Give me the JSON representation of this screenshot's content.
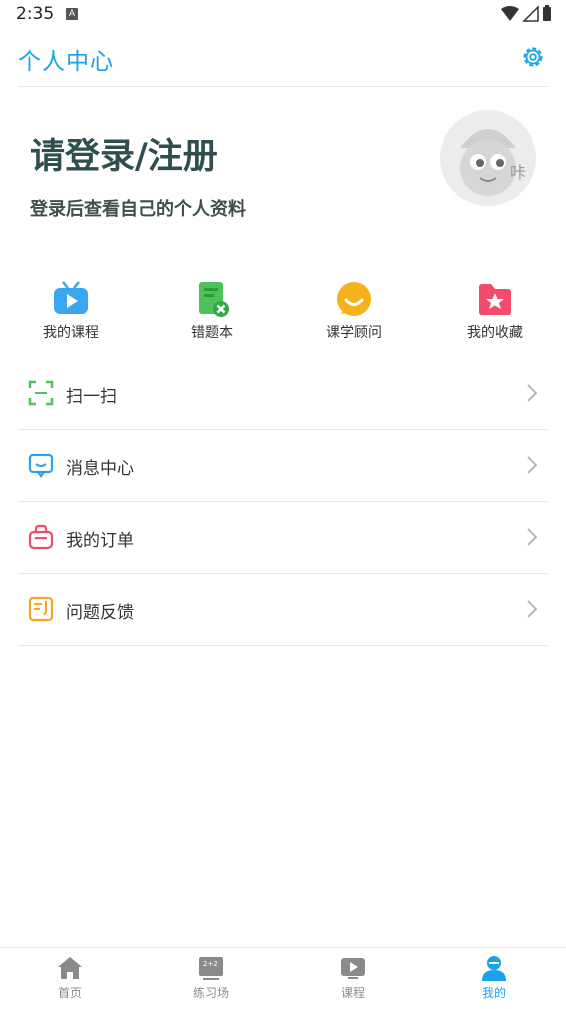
{
  "status": {
    "time": "2:35",
    "notification_letter": "A"
  },
  "header": {
    "title": "个人中心",
    "settings_icon": "gear-icon"
  },
  "profile": {
    "login_title": "请登录/注册",
    "login_subtitle": "登录后查看自己的个人资料",
    "avatar_icon": "mascot-avatar"
  },
  "quick_actions": [
    {
      "label": "我的课程",
      "icon": "video-tv-icon"
    },
    {
      "label": "错题本",
      "icon": "mistake-book-icon"
    },
    {
      "label": "课学顾问",
      "icon": "advisor-chat-icon"
    },
    {
      "label": "我的收藏",
      "icon": "favorites-folder-icon"
    }
  ],
  "menu": [
    {
      "label": "扫一扫",
      "icon": "scan-icon"
    },
    {
      "label": "消息中心",
      "icon": "message-icon"
    },
    {
      "label": "我的订单",
      "icon": "order-bag-icon"
    },
    {
      "label": "问题反馈",
      "icon": "feedback-icon"
    }
  ],
  "tabbar": [
    {
      "label": "首页",
      "icon": "home-icon",
      "active": false
    },
    {
      "label": "练习场",
      "icon": "practice-board-icon",
      "active": false
    },
    {
      "label": "课程",
      "icon": "course-play-icon",
      "active": false
    },
    {
      "label": "我的",
      "icon": "user-icon",
      "active": true
    }
  ],
  "colors": {
    "accent": "#1aa3ea",
    "title_text": "#2f4f4f"
  }
}
